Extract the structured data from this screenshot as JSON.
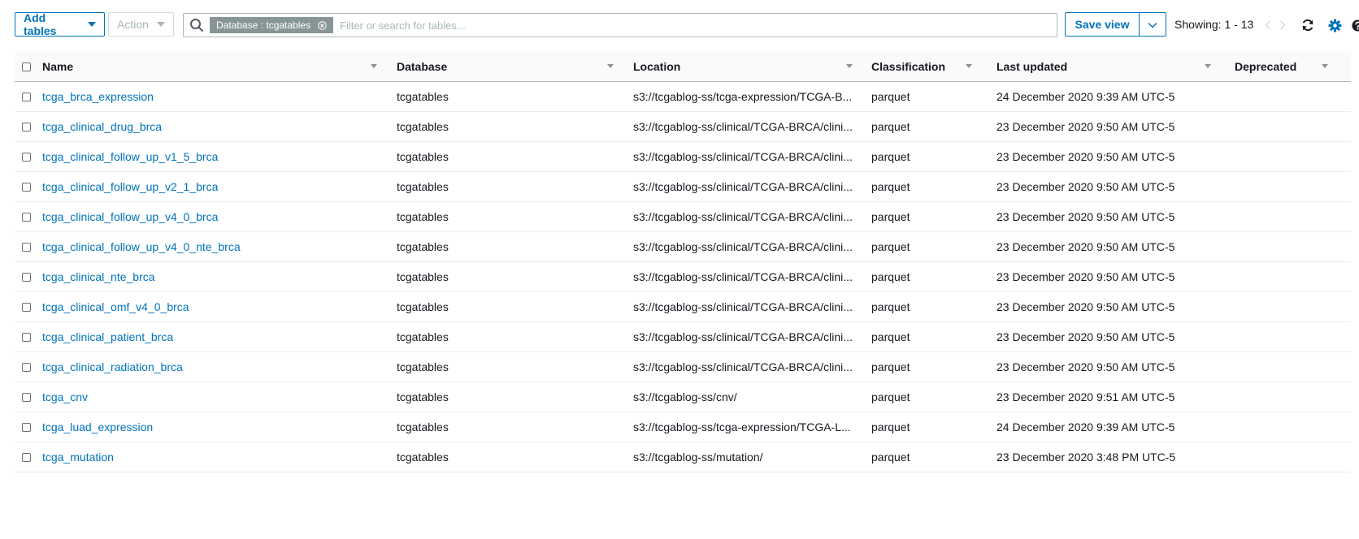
{
  "toolbar": {
    "add_tables_label": "Add tables",
    "action_label": "Action",
    "search": {
      "token_label": "Database : tcgatables",
      "placeholder": "Filter or search for tables..."
    },
    "save_view_label": "Save view",
    "showing_label": "Showing: 1 - 13"
  },
  "icons": {
    "accent": "#0073bb",
    "link_color": "#0073bb",
    "token_color": "#879596"
  },
  "table": {
    "columns": {
      "name": "Name",
      "database": "Database",
      "location": "Location",
      "classification": "Classification",
      "last_updated": "Last updated",
      "deprecated": "Deprecated"
    },
    "rows": [
      {
        "name": "tcga_brca_expression",
        "database": "tcgatables",
        "location": "s3://tcgablog-ss/tcga-expression/TCGA-B...",
        "classification": "parquet",
        "last_updated": "24 December 2020 9:39 AM UTC-5",
        "deprecated": ""
      },
      {
        "name": "tcga_clinical_drug_brca",
        "database": "tcgatables",
        "location": "s3://tcgablog-ss/clinical/TCGA-BRCA/clini...",
        "classification": "parquet",
        "last_updated": "23 December 2020 9:50 AM UTC-5",
        "deprecated": ""
      },
      {
        "name": "tcga_clinical_follow_up_v1_5_brca",
        "database": "tcgatables",
        "location": "s3://tcgablog-ss/clinical/TCGA-BRCA/clini...",
        "classification": "parquet",
        "last_updated": "23 December 2020 9:50 AM UTC-5",
        "deprecated": ""
      },
      {
        "name": "tcga_clinical_follow_up_v2_1_brca",
        "database": "tcgatables",
        "location": "s3://tcgablog-ss/clinical/TCGA-BRCA/clini...",
        "classification": "parquet",
        "last_updated": "23 December 2020 9:50 AM UTC-5",
        "deprecated": ""
      },
      {
        "name": "tcga_clinical_follow_up_v4_0_brca",
        "database": "tcgatables",
        "location": "s3://tcgablog-ss/clinical/TCGA-BRCA/clini...",
        "classification": "parquet",
        "last_updated": "23 December 2020 9:50 AM UTC-5",
        "deprecated": ""
      },
      {
        "name": "tcga_clinical_follow_up_v4_0_nte_brca",
        "database": "tcgatables",
        "location": "s3://tcgablog-ss/clinical/TCGA-BRCA/clini...",
        "classification": "parquet",
        "last_updated": "23 December 2020 9:50 AM UTC-5",
        "deprecated": ""
      },
      {
        "name": "tcga_clinical_nte_brca",
        "database": "tcgatables",
        "location": "s3://tcgablog-ss/clinical/TCGA-BRCA/clini...",
        "classification": "parquet",
        "last_updated": "23 December 2020 9:50 AM UTC-5",
        "deprecated": ""
      },
      {
        "name": "tcga_clinical_omf_v4_0_brca",
        "database": "tcgatables",
        "location": "s3://tcgablog-ss/clinical/TCGA-BRCA/clini...",
        "classification": "parquet",
        "last_updated": "23 December 2020 9:50 AM UTC-5",
        "deprecated": ""
      },
      {
        "name": "tcga_clinical_patient_brca",
        "database": "tcgatables",
        "location": "s3://tcgablog-ss/clinical/TCGA-BRCA/clini...",
        "classification": "parquet",
        "last_updated": "23 December 2020 9:50 AM UTC-5",
        "deprecated": ""
      },
      {
        "name": "tcga_clinical_radiation_brca",
        "database": "tcgatables",
        "location": "s3://tcgablog-ss/clinical/TCGA-BRCA/clini...",
        "classification": "parquet",
        "last_updated": "23 December 2020 9:50 AM UTC-5",
        "deprecated": ""
      },
      {
        "name": "tcga_cnv",
        "database": "tcgatables",
        "location": "s3://tcgablog-ss/cnv/",
        "classification": "parquet",
        "last_updated": "23 December 2020 9:51 AM UTC-5",
        "deprecated": ""
      },
      {
        "name": "tcga_luad_expression",
        "database": "tcgatables",
        "location": "s3://tcgablog-ss/tcga-expression/TCGA-L...",
        "classification": "parquet",
        "last_updated": "24 December 2020 9:39 AM UTC-5",
        "deprecated": ""
      },
      {
        "name": "tcga_mutation",
        "database": "tcgatables",
        "location": "s3://tcgablog-ss/mutation/",
        "classification": "parquet",
        "last_updated": "23 December 2020 3:48 PM UTC-5",
        "deprecated": ""
      }
    ]
  }
}
